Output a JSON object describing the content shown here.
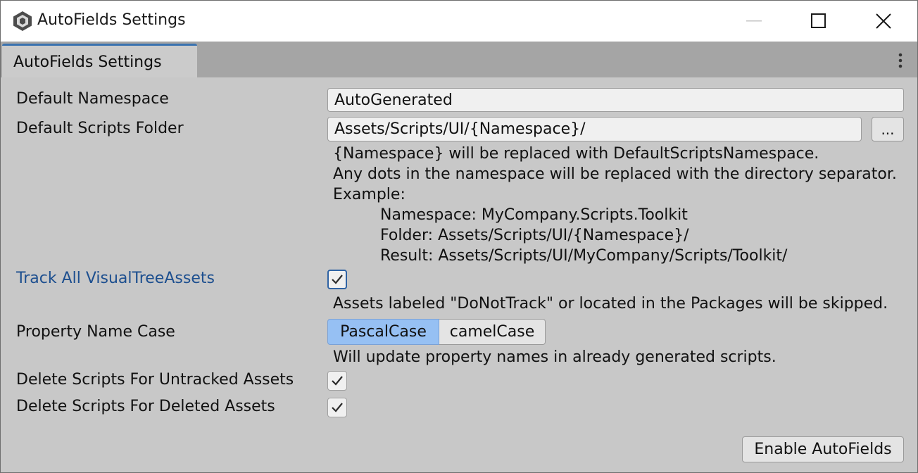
{
  "window": {
    "title": "AutoFields Settings",
    "icon": "unity-logo-icon"
  },
  "tab": {
    "label": "AutoFields Settings"
  },
  "settings": {
    "default_namespace": {
      "label": "Default Namespace",
      "value": "AutoGenerated"
    },
    "default_scripts_folder": {
      "label": "Default Scripts Folder",
      "value": "Assets/Scripts/UI/{Namespace}/",
      "browse_label": "...",
      "help": [
        "{Namespace} will be replaced with DefaultScriptsNamespace.",
        "Any dots in the namespace will be replaced with the directory separator.",
        "Example:"
      ],
      "example": [
        "Namespace: MyCompany.Scripts.Toolkit",
        "Folder: Assets/Scripts/UI/{Namespace}/",
        "Result: Assets/Scripts/UI/MyCompany/Scripts/Toolkit/"
      ]
    },
    "track_all": {
      "label": "Track All VisualTreeAssets",
      "checked": true,
      "help": "Assets labeled \"DoNotTrack\" or located in the Packages will be skipped."
    },
    "property_name_case": {
      "label": "Property Name Case",
      "options": [
        "PascalCase",
        "camelCase"
      ],
      "selected": "PascalCase",
      "help": "Will update property names in already generated scripts."
    },
    "delete_untracked": {
      "label": "Delete Scripts For Untracked Assets",
      "checked": true
    },
    "delete_deleted": {
      "label": "Delete Scripts For Deleted Assets",
      "checked": true
    }
  },
  "actions": {
    "enable_label": "Enable AutoFields"
  },
  "colors": {
    "accent_tab": "#3a72b0",
    "selected_toggle": "#96c0f3",
    "highlight_label": "#1d4f8f",
    "panel_bg": "#c8c8c8"
  }
}
